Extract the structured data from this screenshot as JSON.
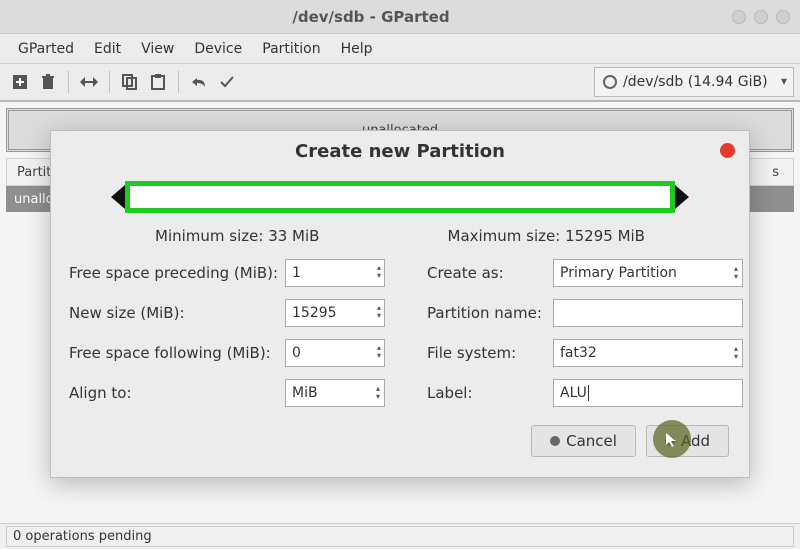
{
  "window": {
    "title": "/dev/sdb - GParted"
  },
  "menubar": {
    "items": [
      "GParted",
      "Edit",
      "View",
      "Device",
      "Partition",
      "Help"
    ]
  },
  "toolbar": {
    "device_label": "/dev/sdb  (14.94 GiB)"
  },
  "diskgraph": {
    "label": "unallocated"
  },
  "table": {
    "col_partition": "Partition",
    "col_flags_trailing": "s",
    "row0": "unallocated"
  },
  "statusbar": {
    "text": "0 operations pending"
  },
  "dialog": {
    "title": "Create new Partition",
    "min_size": "Minimum size: 33 MiB",
    "max_size": "Maximum size: 15295 MiB",
    "labels": {
      "free_preceding": "Free space preceding (MiB):",
      "new_size": "New size (MiB):",
      "free_following": "Free space following (MiB):",
      "align_to": "Align to:",
      "create_as": "Create as:",
      "partition_name": "Partition name:",
      "file_system": "File system:",
      "label": "Label:"
    },
    "values": {
      "free_preceding": "1",
      "new_size": "15295",
      "free_following": "0",
      "align_to": "MiB",
      "create_as": "Primary Partition",
      "partition_name": "",
      "file_system": "fat32",
      "label": "ALU"
    },
    "buttons": {
      "cancel": "Cancel",
      "add": "Add"
    }
  }
}
